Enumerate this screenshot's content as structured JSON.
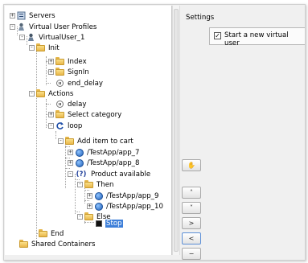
{
  "tree": {
    "nodes": [
      {
        "label": "Servers",
        "icon": "server-icon",
        "exp": "+"
      },
      {
        "label": "Virtual User Profiles",
        "icon": "user-profile-icon",
        "exp": "-"
      },
      {
        "label": "VirtualUser_1",
        "icon": "user-icon",
        "exp": "-"
      },
      {
        "label": "Init",
        "icon": "folder-icon",
        "exp": "-"
      },
      {
        "label": "Index",
        "icon": "folder-icon",
        "exp": "+"
      },
      {
        "label": "SignIn",
        "icon": "folder-icon",
        "exp": "+"
      },
      {
        "label": "end_delay",
        "icon": "delay-icon",
        "exp": ""
      },
      {
        "label": "Actions",
        "icon": "folder-icon",
        "exp": "-"
      },
      {
        "label": "delay",
        "icon": "delay-icon",
        "exp": ""
      },
      {
        "label": "Select category",
        "icon": "folder-icon",
        "exp": "+"
      },
      {
        "label": "loop",
        "icon": "loop-icon",
        "exp": "-"
      },
      {
        "label": "Add item to cart",
        "icon": "folder-icon",
        "exp": "-"
      },
      {
        "label": "/TestApp/app_7",
        "icon": "app-request-icon",
        "exp": "+"
      },
      {
        "label": "/TestApp/app_8",
        "icon": "app-request-icon",
        "exp": "+"
      },
      {
        "label": "Product available",
        "icon": "condition-icon",
        "exp": "-"
      },
      {
        "label": "Then",
        "icon": "folder-icon",
        "exp": "-"
      },
      {
        "label": "/TestApp/app_9",
        "icon": "app-request-icon",
        "exp": "+"
      },
      {
        "label": "/TestApp/app_10",
        "icon": "app-request-icon",
        "exp": "+"
      },
      {
        "label": "Else",
        "icon": "folder-icon",
        "exp": "-"
      },
      {
        "label": "Stop",
        "icon": "stop-icon",
        "exp": "",
        "selected": true
      },
      {
        "label": "End",
        "icon": "folder-icon",
        "exp": ""
      },
      {
        "label": "Shared Containers",
        "icon": "folder-icon",
        "exp": ""
      }
    ]
  },
  "settings": {
    "title": "Settings",
    "start_new_user_label": "Start a new virtual user",
    "start_new_user_checked": true
  },
  "buttons": {
    "hand": "✋",
    "up": "˄",
    "down": "˅",
    "right": ">",
    "left": "<",
    "remove": "−"
  }
}
